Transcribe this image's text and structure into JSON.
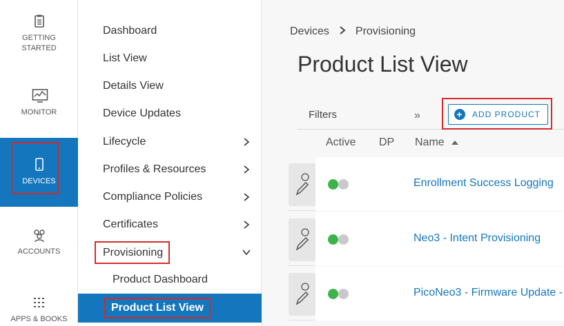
{
  "rail": {
    "items": [
      {
        "label_line1": "GETTING",
        "label_line2": "STARTED",
        "icon": "clipboard-icon"
      },
      {
        "label_line1": "MONITOR",
        "icon": "monitor-chart-icon"
      },
      {
        "label_line1": "DEVICES",
        "icon": "mobile-device-icon"
      },
      {
        "label_line1": "ACCOUNTS",
        "icon": "people-icon"
      },
      {
        "label_line1": "APPS & BOOKS",
        "icon": "grid-dots-icon"
      }
    ],
    "active_color": "#1476bd"
  },
  "subnav": {
    "items": [
      {
        "label": "Dashboard"
      },
      {
        "label": "List View"
      },
      {
        "label": "Details View"
      },
      {
        "label": "Device Updates"
      },
      {
        "label": "Lifecycle"
      },
      {
        "label": "Profiles & Resources"
      },
      {
        "label": "Compliance Policies"
      },
      {
        "label": "Certificates"
      },
      {
        "label": "Provisioning"
      }
    ],
    "sub_items": [
      {
        "label": "Product Dashboard"
      },
      {
        "label": "Product List View"
      }
    ]
  },
  "breadcrumb": {
    "parent": "Devices",
    "separator": ">",
    "current": "Provisioning"
  },
  "page": {
    "title": "Product List View"
  },
  "toolbar": {
    "filters_label": "Filters",
    "collapse_icon": "»",
    "add_product_label": "ADD PRODUCT"
  },
  "table": {
    "columns": [
      "Active",
      "DP",
      "Name"
    ],
    "rows": [
      {
        "name": "Enrollment Success Logging",
        "active": true
      },
      {
        "name": "Neo3 - Intent Provisioning",
        "active": true
      },
      {
        "name": "PicoNeo3 - Firmware Update -",
        "active": true
      }
    ]
  },
  "colors": {
    "accent": "#1476bd",
    "highlight": "#d42a2a",
    "toggle_on": "#3cb44b"
  }
}
